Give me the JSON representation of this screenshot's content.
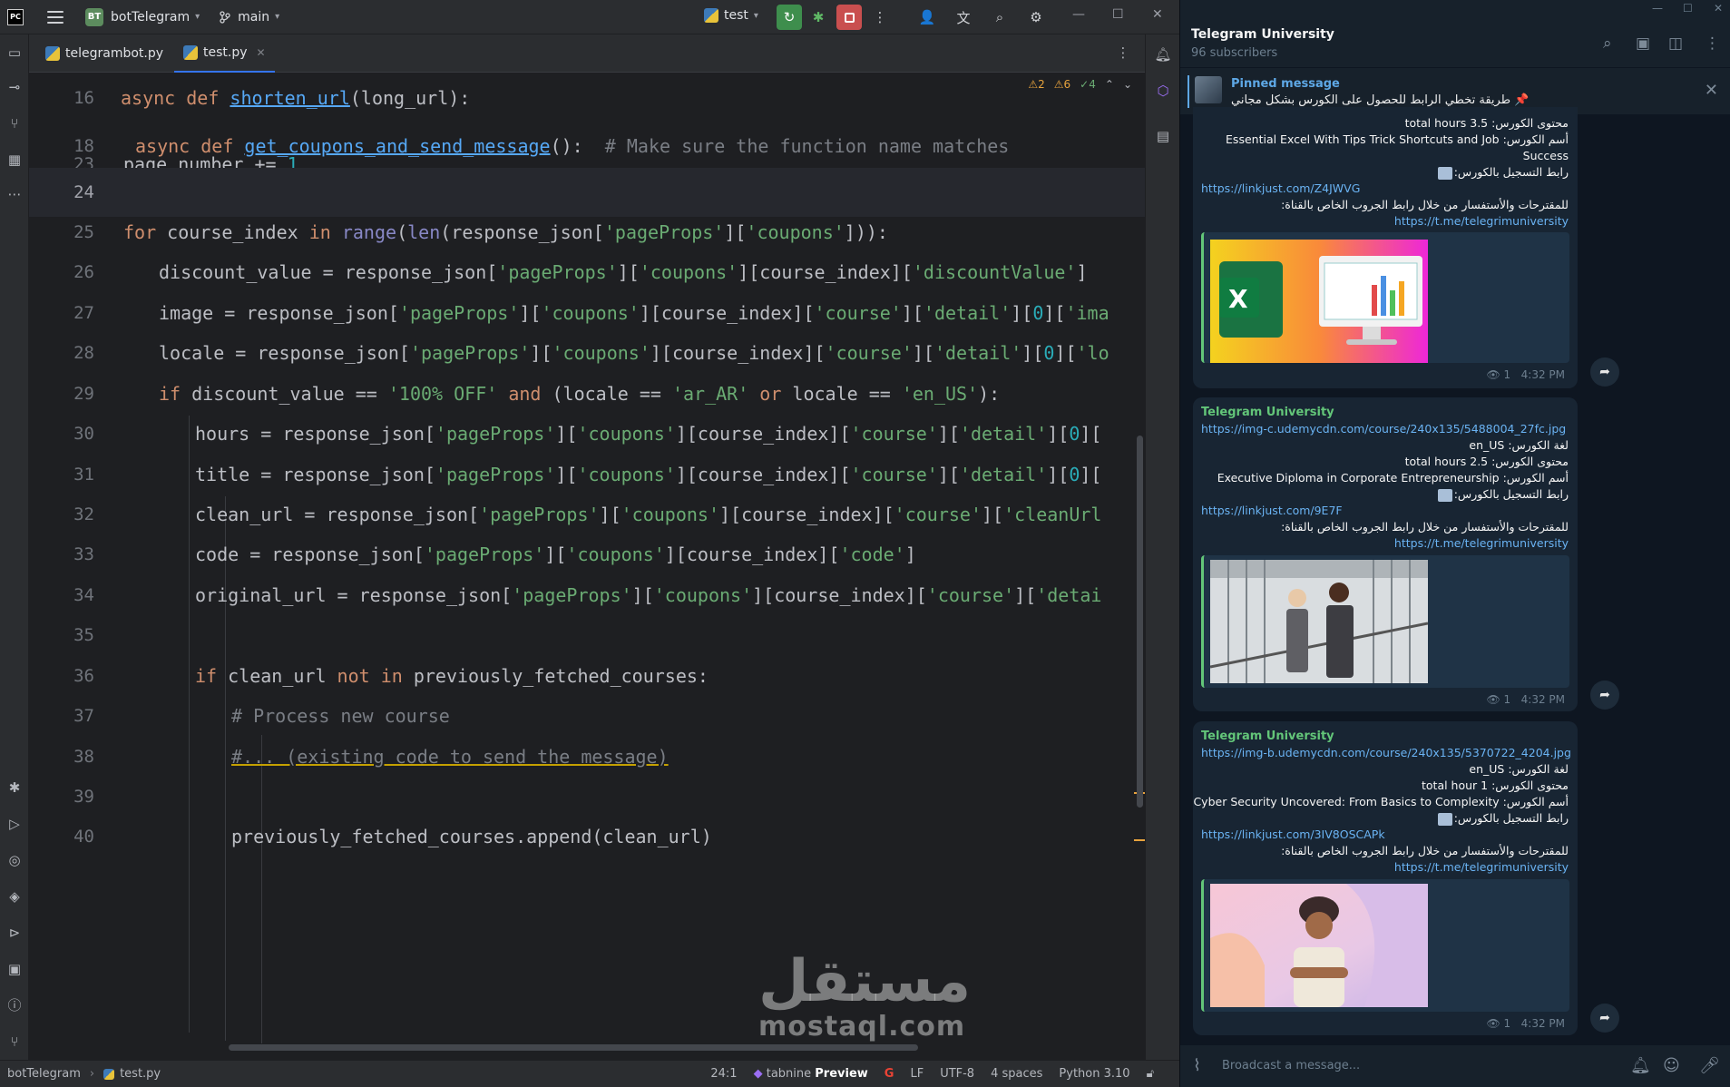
{
  "ide": {
    "app_logo": "PC",
    "project_badge": "BT",
    "project_name": "botTelegram",
    "branch": "main",
    "run_config": "test",
    "tabs": [
      {
        "label": "telegrambot.py"
      },
      {
        "label": "test.py"
      }
    ],
    "inspections": {
      "warn1": "2",
      "warn2": "6",
      "ok": "4"
    },
    "gutter": [
      "16",
      "18",
      "23",
      "24",
      "25",
      "26",
      "27",
      "28",
      "29",
      "30",
      "31",
      "32",
      "33",
      "34",
      "35",
      "36",
      "37",
      "38",
      "39",
      "40"
    ],
    "status": {
      "project": "botTelegram",
      "file": "test.py",
      "position": "24:1",
      "tabnine": "tabnine",
      "tabnine_preview": "Preview",
      "line_sep": "LF",
      "encoding": "UTF-8",
      "indent": "4 spaces",
      "interpreter": "Python 3.10"
    },
    "code": {
      "l16_kw": "async def ",
      "l16_fn": "shorten_url",
      "l16_rest": "(long_url):",
      "l18_kw": "async def ",
      "l18_fn": "get_coupons_and_send_message",
      "l18_rest": "():  ",
      "l18_cmt": "# Make sure the function name matches",
      "l23_a": "page_number += ",
      "l23_num": "1",
      "l25_kw1": "for ",
      "l25_a": "course_index ",
      "l25_kw2": "in ",
      "l25_bi1": "range",
      "l25_b": "(",
      "l25_bi2": "len",
      "l25_c": "(response_json[",
      "l25_s1": "'pageProps'",
      "l25_d": "][",
      "l25_s2": "'coupons'",
      "l25_e": "])):",
      "l26_a": "discount_value = response_json[",
      "l26_s1": "'pageProps'",
      "l26_b": "][",
      "l26_s2": "'coupons'",
      "l26_c": "][course_index][",
      "l26_s3": "'discountValue'",
      "l26_d": "]",
      "l27_a": "image = response_json[",
      "l27_s1": "'pageProps'",
      "l27_b": "][",
      "l27_s2": "'coupons'",
      "l27_c": "][course_index][",
      "l27_s3": "'course'",
      "l27_d": "][",
      "l27_s4": "'detail'",
      "l27_e": "][",
      "l27_n": "0",
      "l27_f": "][",
      "l27_s5": "'ima",
      "l28_a": "locale = response_json[",
      "l28_s1": "'pageProps'",
      "l28_b": "][",
      "l28_s2": "'coupons'",
      "l28_c": "][course_index][",
      "l28_s3": "'course'",
      "l28_d": "][",
      "l28_s4": "'detail'",
      "l28_e": "][",
      "l28_n": "0",
      "l28_f": "][",
      "l28_s5": "'lo",
      "l29_kw1": "if ",
      "l29_a": "discount_value == ",
      "l29_s1": "'100% OFF' ",
      "l29_kw2": "and ",
      "l29_b": "(locale == ",
      "l29_s2": "'ar_AR' ",
      "l29_kw3": "or ",
      "l29_c": "locale == ",
      "l29_s3": "'en_US'",
      "l29_d": "):",
      "l30_a": "hours = response_json[",
      "l30_s1": "'pageProps'",
      "l30_b": "][",
      "l30_s2": "'coupons'",
      "l30_c": "][course_index][",
      "l30_s3": "'course'",
      "l30_d": "][",
      "l30_s4": "'detail'",
      "l30_e": "][",
      "l30_n": "0",
      "l30_f": "][",
      "l31_a": "title = response_json[",
      "l31_s1": "'pageProps'",
      "l31_b": "][",
      "l31_s2": "'coupons'",
      "l31_c": "][course_index][",
      "l31_s3": "'course'",
      "l31_d": "][",
      "l31_s4": "'detail'",
      "l31_e": "][",
      "l31_n": "0",
      "l31_f": "][",
      "l32_a": "clean_url = response_json[",
      "l32_s1": "'pageProps'",
      "l32_b": "][",
      "l32_s2": "'coupons'",
      "l32_c": "][course_index][",
      "l32_s3": "'course'",
      "l32_d": "][",
      "l32_s4": "'cleanUrl",
      "l33_a": "code = response_json[",
      "l33_s1": "'pageProps'",
      "l33_b": "][",
      "l33_s2": "'coupons'",
      "l33_c": "][course_index][",
      "l33_s3": "'code'",
      "l33_d": "]",
      "l34_a": "original_url = response_json[",
      "l34_s1": "'pageProps'",
      "l34_b": "][",
      "l34_s2": "'coupons'",
      "l34_c": "][course_index][",
      "l34_s3": "'course'",
      "l34_d": "][",
      "l34_s4": "'detai",
      "l36_kw1": "if ",
      "l36_a": "clean_url ",
      "l36_kw2": "not in ",
      "l36_b": "previously_fetched_courses:",
      "l37_cmt": "# Process new course",
      "l38_cmt": "#... (existing code to send the message)",
      "l40_a": "previously_fetched_courses.append(clean_url)"
    }
  },
  "watermark": {
    "arabic": "مستقل",
    "latin": "mostaql.com"
  },
  "telegram": {
    "channel": "Telegram University",
    "subscribers": "96 subscribers",
    "pinned_label": "Pinned message",
    "pinned_text": "📌 طريقة تخطي الرابط للحصول على الكورس بشكل مجاني",
    "input_placeholder": "Broadcast a message...",
    "messages": [
      {
        "lines": [
          "محتوى الكورس: total hours 3.5",
          "أسم الكورس: Essential Excel With Tips Trick Shortcuts and Job",
          "Success",
          "رابط التسجيل بالكورس:"
        ],
        "reg_link": "https://linkjust.com/Z4JWVG",
        "footer_text": "للمقترحات والأستفسار من خلال رابط الجروب الخاص بالقناة:",
        "footer_link": "https://t.me/telegrimuniversity",
        "views": "1",
        "time": "4:32 PM"
      },
      {
        "sender": "Telegram University",
        "img_link": "https://img-c.udemycdn.com/course/240x135/5488004_27fc.jpg",
        "lines": [
          "لغة الكورس: en_US",
          "محتوى الكورس: total hours 2.5",
          "أسم الكورس: Executive Diploma in Corporate Entrepreneurship",
          "رابط التسجيل بالكورس:"
        ],
        "reg_link": "https://linkjust.com/9E7F",
        "footer_text": "للمقترحات والأستفسار من خلال رابط الجروب الخاص بالقناة:",
        "footer_link": "https://t.me/telegrimuniversity",
        "views": "1",
        "time": "4:32 PM"
      },
      {
        "sender": "Telegram University",
        "img_link": "https://img-b.udemycdn.com/course/240x135/5370722_4204.jpg",
        "lines": [
          "لغة الكورس: en_US",
          "محتوى الكورس: total hour 1",
          "أسم الكورس: Cyber Security Uncovered:  From Basics to Complexity",
          "رابط التسجيل بالكورس:"
        ],
        "reg_link": "https://linkjust.com/3IV8OSCAPk",
        "footer_text": "للمقترحات والأستفسار من خلال رابط الجروب الخاص بالقناة:",
        "footer_link": "https://t.me/telegrimuniversity",
        "views": "1",
        "time": "4:32 PM"
      }
    ]
  }
}
